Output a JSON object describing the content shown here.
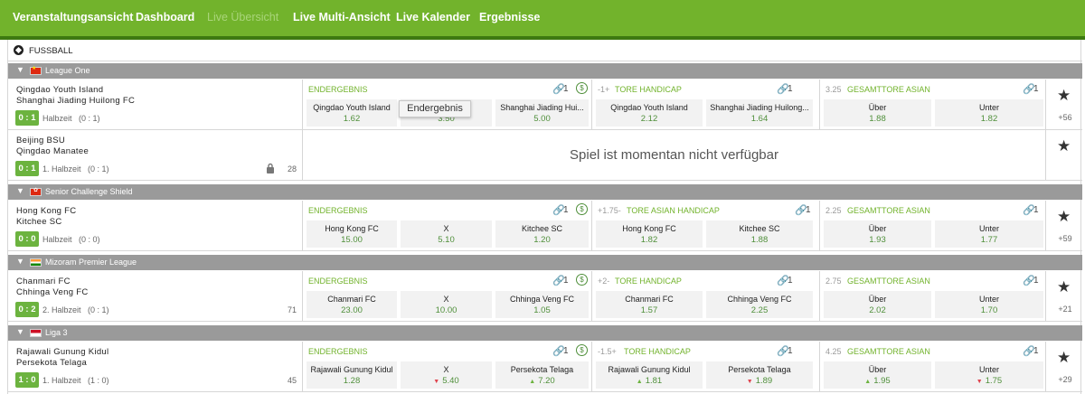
{
  "nav": {
    "items": [
      {
        "label": "Veranstaltungsansicht"
      },
      {
        "label": "Dashboard"
      },
      {
        "label": "Live Übersicht"
      },
      {
        "label": "Live Multi-Ansicht"
      },
      {
        "label": "Live Kalender"
      },
      {
        "label": "Ergebnisse"
      }
    ]
  },
  "sport": {
    "label": "FUSSBALL",
    "icon": "soccer-ball-icon"
  },
  "colors": {
    "nav": "#72b32c",
    "score": "#6cb33f",
    "odds": "#4f8f3a",
    "league_bar": "#9a9a9a"
  },
  "leagues": [
    {
      "name": "League One",
      "flag": "china-flag"
    },
    {
      "name": "Senior Challenge Shield",
      "flag": "hong-kong-flag"
    },
    {
      "name": "Mizoram Premier League",
      "flag": "india-flag"
    },
    {
      "name": "Liga 3",
      "flag": "indonesia-flag"
    }
  ],
  "matches": [
    {
      "team1": "Qingdao Youth Island",
      "team2": "Shanghai Jiading Huilong FC",
      "score": "0 : 1",
      "period": "Halbzeit",
      "ht": "(0 : 1)",
      "more": "+56",
      "m1": {
        "name": "ENDERGEBNIS",
        "count": "1",
        "o1": {
          "label": "Qingdao Youth Island",
          "val": "1.62"
        },
        "o2": {
          "label": "X",
          "val": "3.50"
        },
        "o3": {
          "label": "Shanghai Jiading Hui...",
          "val": "5.00"
        }
      },
      "m2": {
        "hcp": "-1+",
        "name": "TORE HANDICAP",
        "count": "1",
        "o1": {
          "label": "Qingdao Youth Island",
          "val": "2.12"
        },
        "o2": {
          "label": "Shanghai Jiading Huilong...",
          "val": "1.64"
        }
      },
      "m3": {
        "hcp": "3.25",
        "name": "GESAMTTORE ASIAN",
        "count": "1",
        "o1": {
          "label": "Über",
          "val": "1.88"
        },
        "o2": {
          "label": "Unter",
          "val": "1.82"
        }
      }
    },
    {
      "team1": "Beijing BSU",
      "team2": "Qingdao Manatee",
      "score": "0 : 1",
      "period": "1. Halbzeit",
      "ht": "(0 : 1)",
      "count": "28",
      "unavailable": "Spiel ist momentan nicht verfügbar"
    },
    {
      "team1": "Hong Kong FC",
      "team2": "Kitchee SC",
      "score": "0 : 0",
      "period": "Halbzeit",
      "ht": "(0 : 0)",
      "more": "+59",
      "m1": {
        "name": "ENDERGEBNIS",
        "count": "1",
        "o1": {
          "label": "Hong Kong FC",
          "val": "15.00"
        },
        "o2": {
          "label": "X",
          "val": "5.10"
        },
        "o3": {
          "label": "Kitchee SC",
          "val": "1.20"
        }
      },
      "m2": {
        "hcp": "+1.75-",
        "name": "TORE ASIAN HANDICAP",
        "count": "1",
        "o1": {
          "label": "Hong Kong FC",
          "val": "1.82"
        },
        "o2": {
          "label": "Kitchee SC",
          "val": "1.88"
        }
      },
      "m3": {
        "hcp": "2.25",
        "name": "GESAMTTORE ASIAN",
        "count": "1",
        "o1": {
          "label": "Über",
          "val": "1.93"
        },
        "o2": {
          "label": "Unter",
          "val": "1.77"
        }
      }
    },
    {
      "team1": "Chanmari FC",
      "team2": "Chhinga Veng FC",
      "score": "0 : 2",
      "period": "2. Halbzeit",
      "ht": "(0 : 1)",
      "count": "71",
      "more": "+21",
      "m1": {
        "name": "ENDERGEBNIS",
        "count": "1",
        "o1": {
          "label": "Chanmari FC",
          "val": "23.00"
        },
        "o2": {
          "label": "X",
          "val": "10.00"
        },
        "o3": {
          "label": "Chhinga Veng FC",
          "val": "1.05"
        }
      },
      "m2": {
        "hcp": "+2-",
        "name": "TORE HANDICAP",
        "count": "1",
        "o1": {
          "label": "Chanmari FC",
          "val": "1.57"
        },
        "o2": {
          "label": "Chhinga Veng FC",
          "val": "2.25"
        }
      },
      "m3": {
        "hcp": "2.75",
        "name": "GESAMTTORE ASIAN",
        "count": "1",
        "o1": {
          "label": "Über",
          "val": "2.02"
        },
        "o2": {
          "label": "Unter",
          "val": "1.70"
        }
      }
    },
    {
      "team1": "Rajawali Gunung Kidul",
      "team2": "Persekota Telaga",
      "score": "1 : 0",
      "period": "1. Halbzeit",
      "ht": "(1 : 0)",
      "count": "45",
      "more": "+29",
      "m1": {
        "name": "ENDERGEBNIS",
        "count": "1",
        "o1": {
          "label": "Rajawali Gunung Kidul",
          "val": "1.28"
        },
        "o2": {
          "label": "X",
          "val": "5.40",
          "trend": "down"
        },
        "o3": {
          "label": "Persekota Telaga",
          "val": "7.20",
          "trend": "up"
        }
      },
      "m2": {
        "hcp": "-1.5+",
        "name": "TORE HANDICAP",
        "count": "1",
        "o1": {
          "label": "Rajawali Gunung Kidul",
          "val": "1.81",
          "trend": "up"
        },
        "o2": {
          "label": "Persekota Telaga",
          "val": "1.89",
          "trend": "down"
        }
      },
      "m3": {
        "hcp": "4.25",
        "name": "GESAMTTORE ASIAN",
        "count": "1",
        "o1": {
          "label": "Über",
          "val": "1.95",
          "trend": "up"
        },
        "o2": {
          "label": "Unter",
          "val": "1.75",
          "trend": "down"
        }
      }
    }
  ],
  "tooltip": "Endergebnis"
}
